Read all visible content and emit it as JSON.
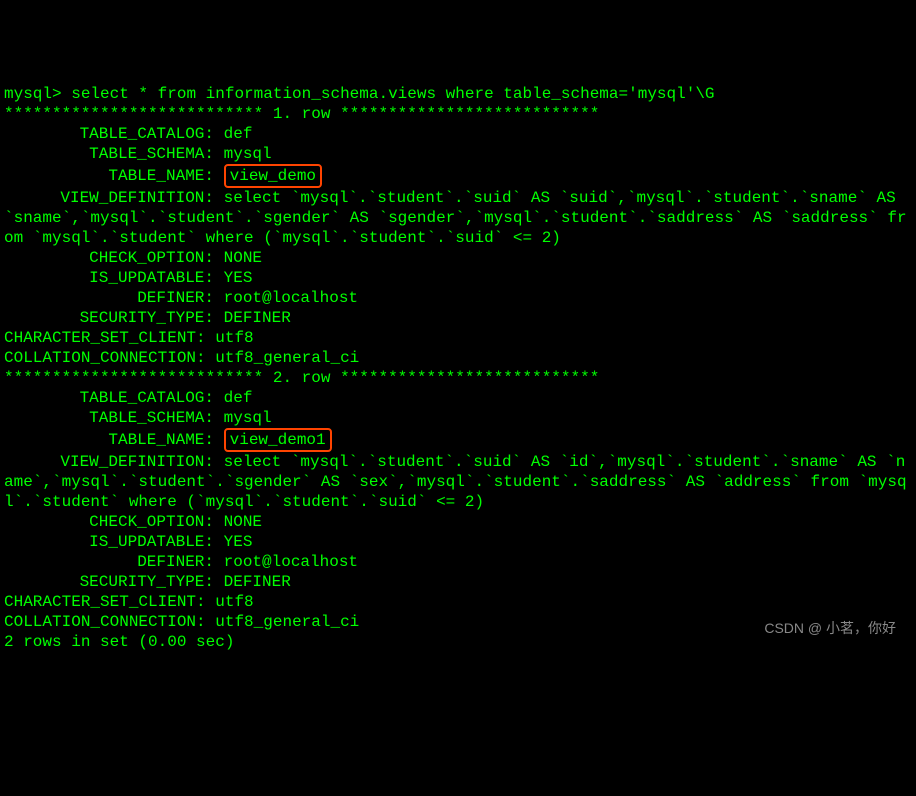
{
  "prompt": "mysql> ",
  "query": "select * from information_schema.views where table_schema='mysql'\\G",
  "stars": "***************************",
  "row_label_1": " 1. row ",
  "row_label_2": " 2. row ",
  "rows": [
    {
      "TABLE_CATALOG": "def",
      "TABLE_SCHEMA": "mysql",
      "TABLE_NAME": "view_demo",
      "VIEW_DEFINITION": "select `mysql`.`student`.`suid` AS `suid`,`mysql`.`student`.`sname` AS `sname`,`mysql`.`student`.`sgender` AS `sgender`,`mysql`.`student`.`saddress` AS `saddress` from `mysql`.`student` where (`mysql`.`student`.`suid` <= 2)",
      "CHECK_OPTION": "NONE",
      "IS_UPDATABLE": "YES",
      "DEFINER": "root@localhost",
      "SECURITY_TYPE": "DEFINER",
      "CHARACTER_SET_CLIENT": "utf8",
      "COLLATION_CONNECTION": "utf8_general_ci"
    },
    {
      "TABLE_CATALOG": "def",
      "TABLE_SCHEMA": "mysql",
      "TABLE_NAME": "view_demo1",
      "VIEW_DEFINITION": "select `mysql`.`student`.`suid` AS `id`,`mysql`.`student`.`sname` AS `name`,`mysql`.`student`.`sgender` AS `sex`,`mysql`.`student`.`saddress` AS `address` from `mysql`.`student` where (`mysql`.`student`.`suid` <= 2)",
      "CHECK_OPTION": "NONE",
      "IS_UPDATABLE": "YES",
      "DEFINER": "root@localhost",
      "SECURITY_TYPE": "DEFINER",
      "CHARACTER_SET_CLIENT": "utf8",
      "COLLATION_CONNECTION": "utf8_general_ci"
    }
  ],
  "labels": {
    "TABLE_CATALOG": "TABLE_CATALOG:",
    "TABLE_SCHEMA": "TABLE_SCHEMA:",
    "TABLE_NAME": "TABLE_NAME:",
    "VIEW_DEFINITION": "VIEW_DEFINITION:",
    "CHECK_OPTION": "CHECK_OPTION:",
    "IS_UPDATABLE": "IS_UPDATABLE:",
    "DEFINER": "DEFINER:",
    "SECURITY_TYPE": "SECURITY_TYPE:",
    "CHARACTER_SET_CLIENT": "CHARACTER_SET_CLIENT:",
    "COLLATION_CONNECTION": "COLLATION_CONNECTION:"
  },
  "summary": "2 rows in set (0.00 sec)",
  "watermark": "CSDN @ 小茗，你好"
}
